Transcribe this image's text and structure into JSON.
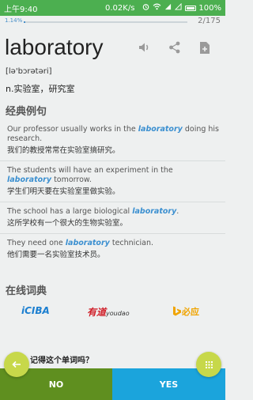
{
  "status_bar": {
    "time": "上午9:40",
    "speed": "0.02K/s",
    "battery": "100%",
    "icons": [
      "alarm-icon",
      "wifi-icon",
      "signal-1-icon",
      "signal-2-icon",
      "battery-icon"
    ]
  },
  "progress": {
    "percent_label": "1.14%",
    "percent_value": 1.14,
    "counter": "2/175"
  },
  "word": {
    "text": "laboratory",
    "phonetic": "[lə'bɔrətəri]",
    "meaning": "n.实验室，研究室",
    "actions": [
      "speaker-icon",
      "share-icon",
      "add-file-icon"
    ]
  },
  "examples": {
    "title": "经典例句",
    "items": [
      {
        "en_before": "Our professor usually works in the ",
        "keyword": "laboratory",
        "en_after": " doing his research.",
        "zh": "我们的教授常常在实验室搞研究。"
      },
      {
        "en_before": "The students will have an experiment in the ",
        "keyword": "laboratory",
        "en_after": " tomorrow.",
        "zh": "学生们明天要在实验室里做实验。"
      },
      {
        "en_before": "The school has a large biological ",
        "keyword": "laboratory",
        "en_after": ".",
        "zh": "这所学校有一个很大的生物实验室。"
      },
      {
        "en_before": "They need one ",
        "keyword": "laboratory",
        "en_after": " technician.",
        "zh": "他们需要一名实验室技术员。"
      }
    ]
  },
  "online_dicts": {
    "title": "在线词典",
    "items": [
      {
        "label": "iCIBA",
        "color": "#1c7fd0"
      },
      {
        "label_prefix": "有道",
        "label_suffix": "youdao",
        "color": "#d0202a"
      },
      {
        "label": "必应",
        "color": "#f0a400"
      }
    ]
  },
  "prompt": {
    "question": "记得这个单词吗？",
    "no_label": "NO",
    "yes_label": "YES"
  },
  "colors": {
    "status_bar": "#4caf50",
    "accent_blue": "#3a8fd0",
    "no_button": "#5f8f1f",
    "yes_button": "#1ba4dc",
    "fab": "#c7d84a"
  }
}
